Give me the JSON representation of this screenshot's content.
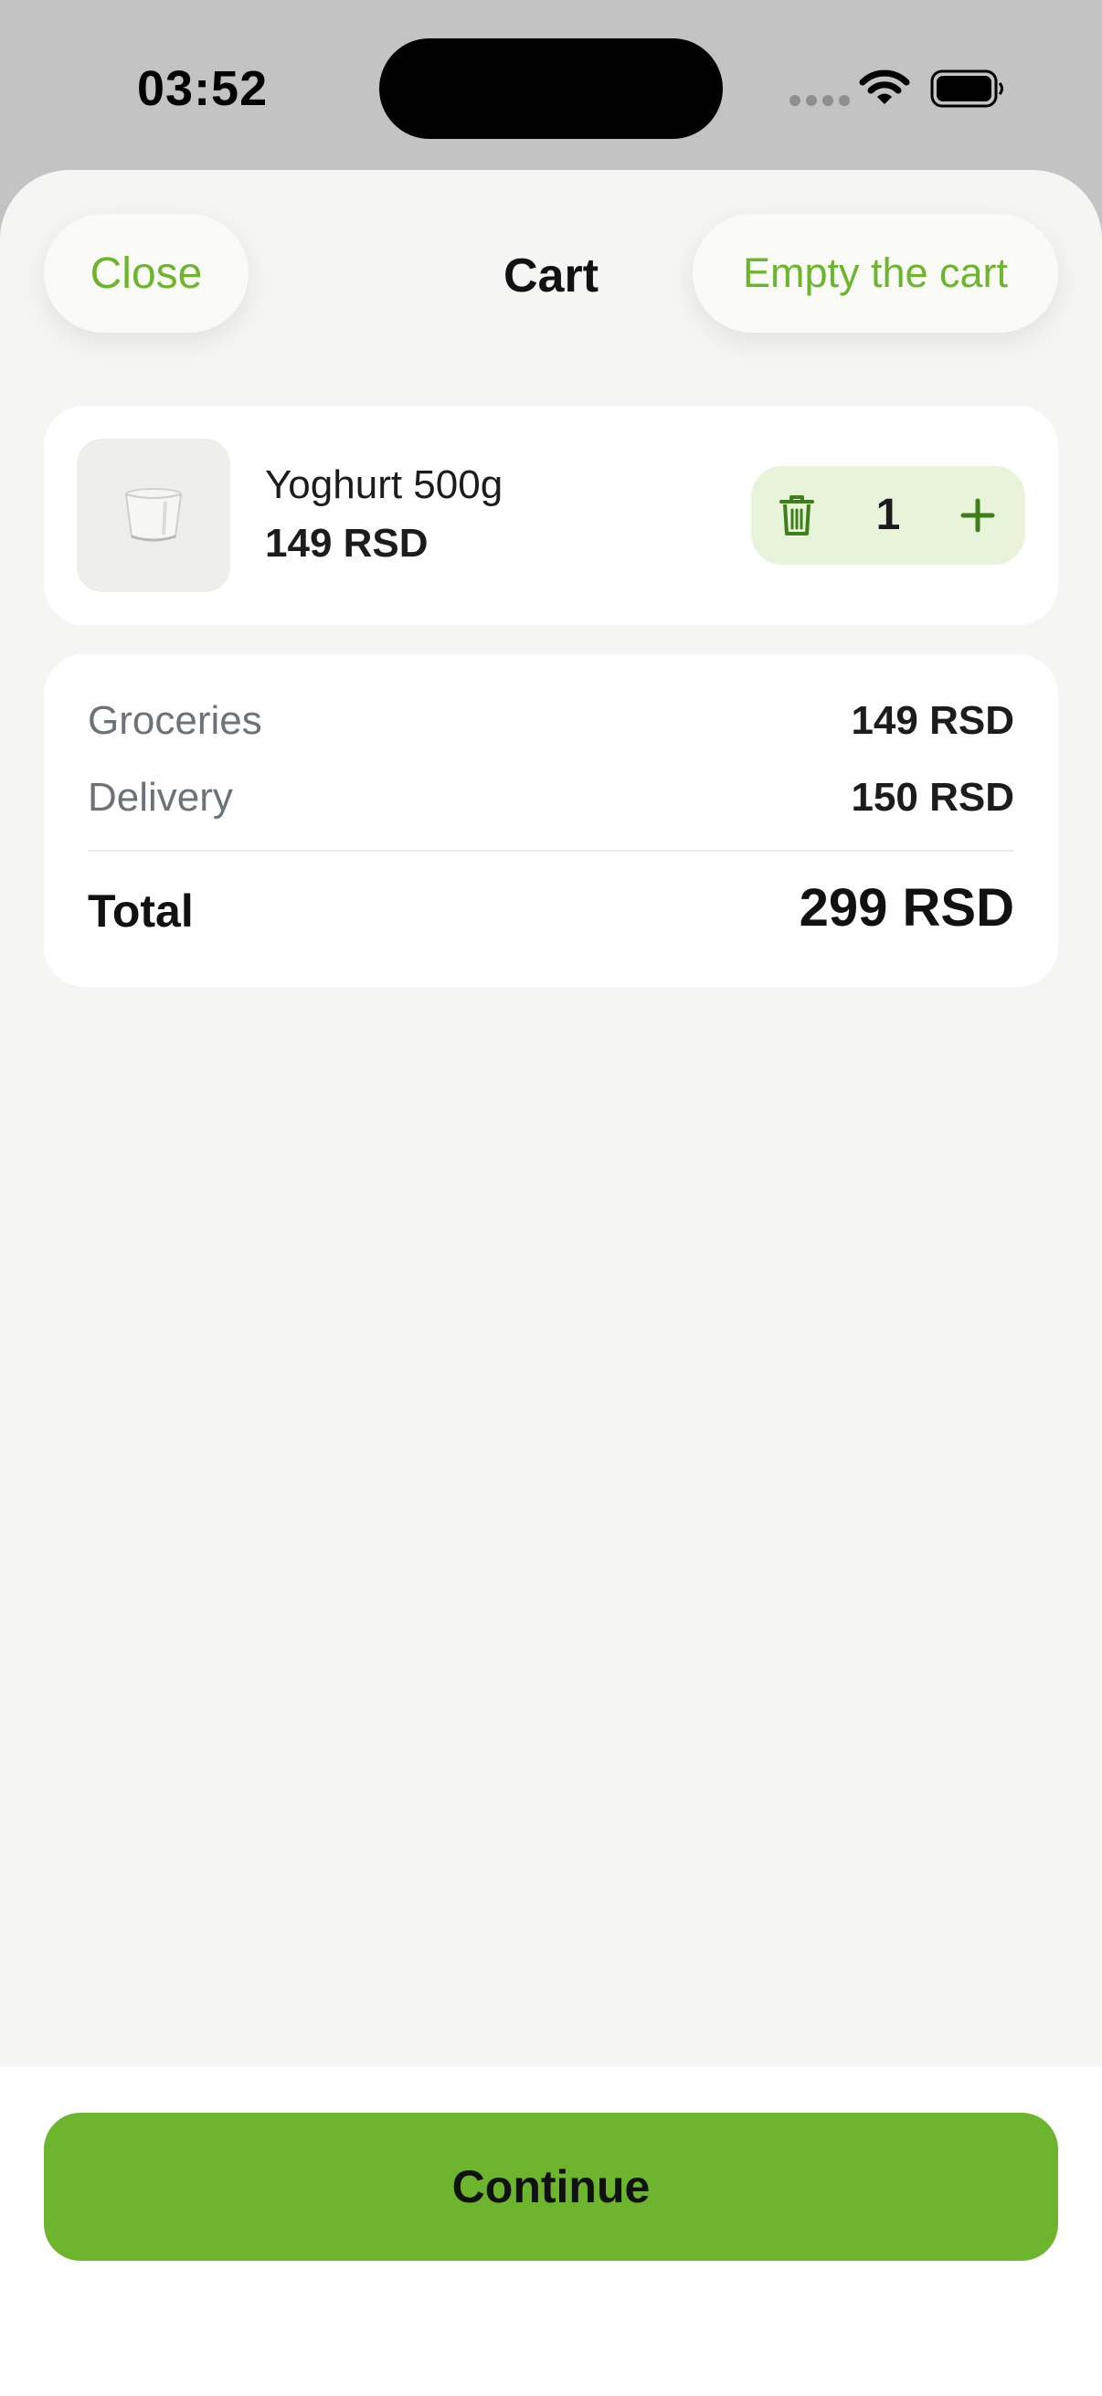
{
  "status_bar": {
    "time": "03:52",
    "icons": [
      "signal-dots-icon",
      "wifi-icon",
      "battery-icon"
    ]
  },
  "header": {
    "close_label": "Close",
    "title": "Cart",
    "empty_label": "Empty the cart"
  },
  "cart": {
    "items": [
      {
        "name": "Yoghurt 500g",
        "price": "149 RSD",
        "quantity": "1",
        "image_icon": "yoghurt-cup-icon"
      }
    ]
  },
  "summary": {
    "groceries_label": "Groceries",
    "groceries_value": "149 RSD",
    "delivery_label": "Delivery",
    "delivery_value": "150 RSD",
    "total_label": "Total",
    "total_value": "299 RSD"
  },
  "footer": {
    "continue_label": "Continue"
  },
  "colors": {
    "accent": "#6cb52d",
    "stepper_bg": "#e7f4da",
    "sheet_bg": "#f5f5f3",
    "card_bg": "#ffffff",
    "muted_text": "#6d7279"
  }
}
